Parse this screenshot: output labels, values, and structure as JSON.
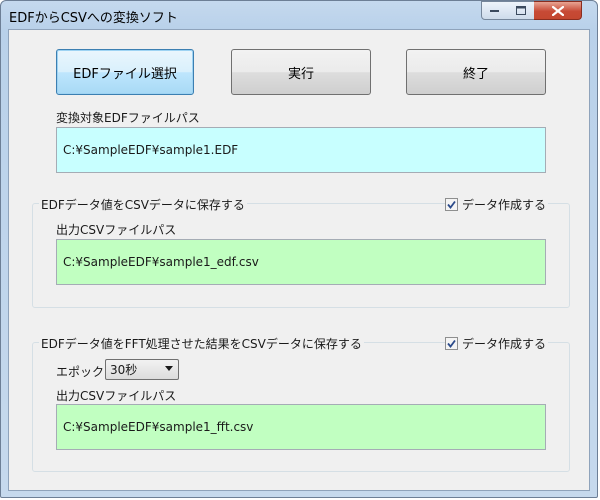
{
  "window": {
    "title": "EDFからCSVへの変換ソフト"
  },
  "buttons": {
    "select_edf": "EDFファイル選択",
    "run": "実行",
    "exit": "終了"
  },
  "input_section": {
    "label": "変換対象EDFファイルパス",
    "path": "C:¥SampleEDF¥sample1.EDF"
  },
  "csv_group": {
    "title": "EDFデータ値をCSVデータに保存する",
    "checkbox_label": "データ作成する",
    "checked": true,
    "output_label": "出力CSVファイルパス",
    "output_path": "C:¥SampleEDF¥sample1_edf.csv"
  },
  "fft_group": {
    "title": "EDFデータ値をFFT処理させた結果をCSVデータに保存する",
    "checkbox_label": "データ作成する",
    "checked": true,
    "epoch_label": "エポック",
    "epoch_value": "30秒",
    "output_label": "出力CSVファイルパス",
    "output_path": "C:¥SampleEDF¥sample1_fft.csv"
  },
  "colors": {
    "input_path_bg": "#c8ffff",
    "output_path_bg": "#c1ffc1",
    "close_button": "#c74a35"
  }
}
